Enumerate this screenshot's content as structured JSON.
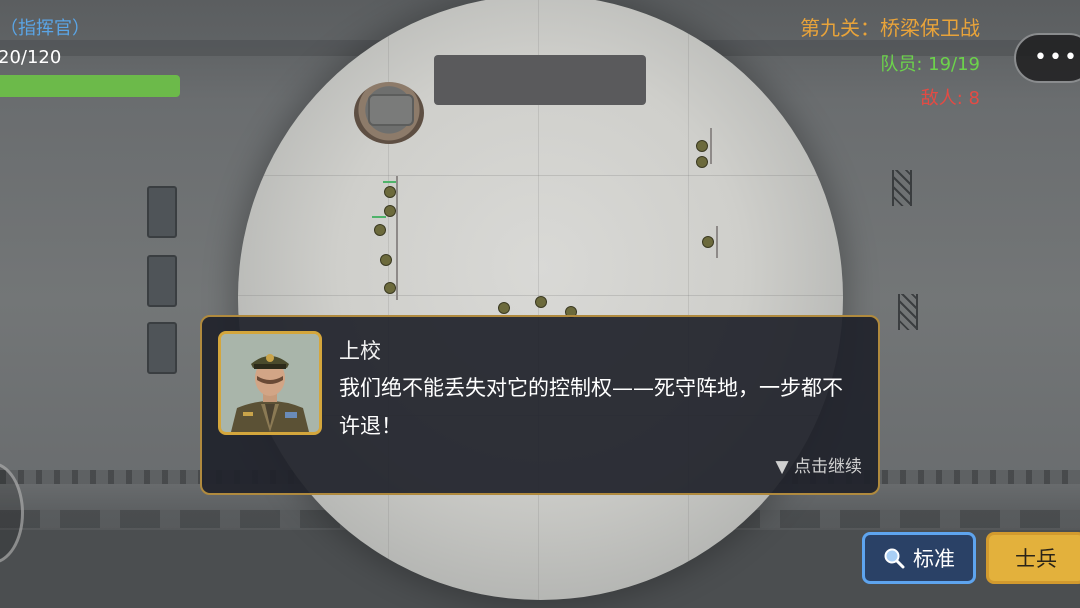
{
  "hud": {
    "commander_label": "（指挥官）",
    "hp_text": "20/120",
    "hp_fraction": 1.0,
    "level_title": "第九关：桥梁保卫战",
    "team_count": "队员: 19/19",
    "enemy_count": "敌人: 8",
    "menu_icon": "more-dots-icon"
  },
  "dialog": {
    "speaker": "上校",
    "line": "我们绝不能丢失对它的控制权——死守阵地，一步都不许退！",
    "continue_hint": "▼ 点击继续"
  },
  "buttons": {
    "standard_label": "标准",
    "standard_icon": "search-icon",
    "soldier_label": "士兵"
  },
  "colors": {
    "commander": "#5aa5e6",
    "level_title": "#e8a33a",
    "team": "#6cd34b",
    "enemy": "#e34b44",
    "dialog_border": "#b08a3e",
    "standard_border": "#5ea4ee",
    "soldier_bg": "#e3b13c"
  }
}
